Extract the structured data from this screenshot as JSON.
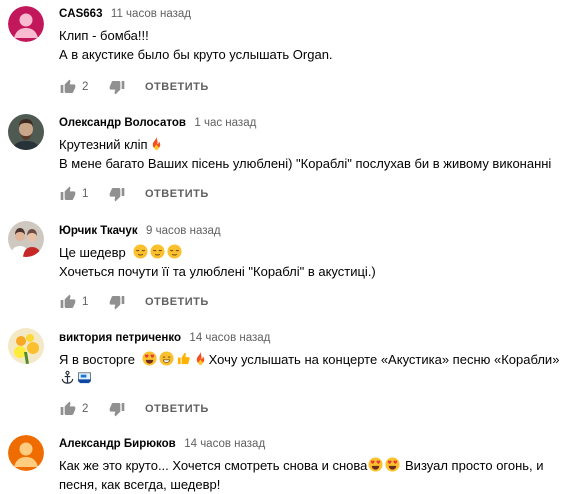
{
  "comments": [
    {
      "author": "CAS663",
      "time": "11 часов назад",
      "lines": [
        "Клип - бомба!!!",
        "А в акустике было бы круто услышать Organ."
      ],
      "likes": "2",
      "reply_label": "ОТВЕТИТЬ",
      "avatar_color": "#c2185b"
    },
    {
      "author": "Олександр Волосатов",
      "time": "1 час назад",
      "lines": [
        "Крутезний кліп",
        "В мене багато Ваших пісень улюблені) \"Кораблі\" послухав би в живому виконанні"
      ],
      "likes": "1",
      "reply_label": "ОТВЕТИТЬ"
    },
    {
      "author": "Юрчик Ткачук",
      "time": "9 часов назад",
      "lines": [
        "Це шедевр",
        "Хочеться почути її та улюблені \"Кораблі\" в акустиці.)"
      ],
      "likes": "1",
      "reply_label": "ОТВЕТИТЬ"
    },
    {
      "author": "виктория петриченко",
      "time": "14 часов назад",
      "lines": [
        "Я в восторге",
        "Хочу услышать на концерте «Акустика» песню «Корабли»"
      ],
      "likes": "2",
      "reply_label": "ОТВЕТИТЬ"
    },
    {
      "author": "Александр Бирюков",
      "time": "14 часов назад",
      "lines": [
        "Как же это круто... Хочется смотреть снова и снова",
        "Визуал просто огонь, и",
        "песня, как всегда, шедевр!"
      ],
      "avatar_color": "#ef6c00"
    }
  ],
  "icons": {
    "like": "thumb-up-icon",
    "dislike": "thumb-down-icon",
    "fire": "fire-emoji-icon",
    "heart_eyes": "heart-eyes-emoji-icon",
    "relieved": "relieved-face-emoji-icon",
    "grin": "grinning-face-emoji-icon",
    "thumbs": "thumbs-up-emoji-icon",
    "anchor": "anchor-emoji-icon",
    "ship": "ship-emoji-icon"
  }
}
